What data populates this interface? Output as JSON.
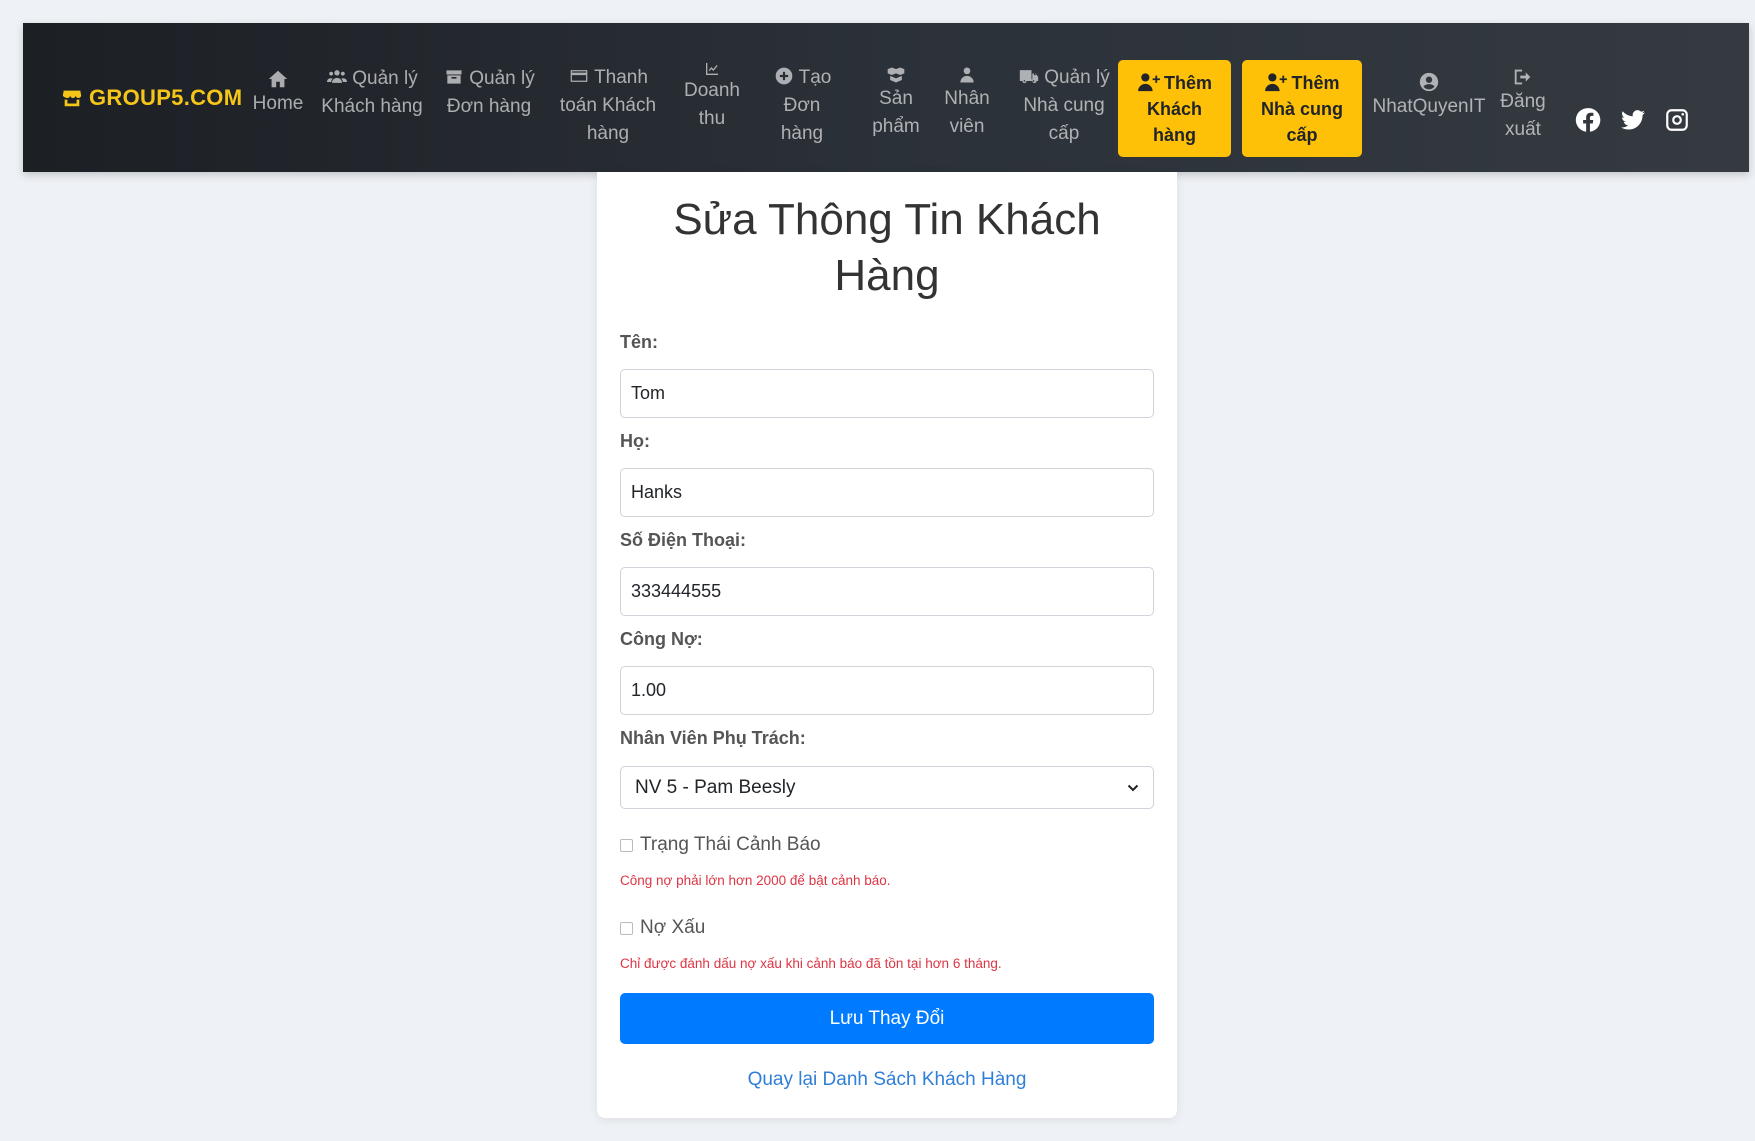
{
  "brand": {
    "name": "GROUP5.COM"
  },
  "nav": {
    "home": "Home",
    "customers_1": "Quản lý",
    "customers_2": "Khách hàng",
    "orders_1": "Quản lý",
    "orders_2": "Đơn hàng",
    "payment_1": "Thanh",
    "payment_2": "toán Khách",
    "payment_3": "hàng",
    "revenue_1": "Doanh",
    "revenue_2": "thu",
    "create_order_1": "Tạo",
    "create_order_2": "Đơn",
    "create_order_3": "hàng",
    "products_1": "Sản",
    "products_2": "phẩm",
    "staff_1": "Nhân",
    "staff_2": "viên",
    "suppliers_1": "Quản lý",
    "suppliers_2": "Nhà cung",
    "suppliers_3": "cấp",
    "add_customer_1": "Thêm",
    "add_customer_2": "Khách",
    "add_customer_3": "hàng",
    "add_supplier_1": "Thêm",
    "add_supplier_2": "Nhà cung",
    "add_supplier_3": "cấp",
    "user": "NhatQuyenIT",
    "logout_1": "Đăng",
    "logout_2": "xuất"
  },
  "icons": {
    "brand": "store-icon",
    "home": "home-icon",
    "customers": "users-icon",
    "orders": "box-icon",
    "payment": "credit-card-icon",
    "revenue": "chart-line-icon",
    "create_order": "plus-circle-icon",
    "products": "boxes-icon",
    "staff": "user-icon",
    "suppliers": "truck-icon",
    "add": "user-plus-icon",
    "user": "user-circle-icon",
    "logout": "sign-out-icon",
    "social": [
      "facebook-icon",
      "twitter-icon",
      "instagram-icon"
    ]
  },
  "colors": {
    "accent": "#ffc107",
    "primary": "#007bff",
    "danger": "#dc3545",
    "link": "#2f7fd8"
  },
  "form": {
    "title_1": "Sửa Thông Tin Khách",
    "title_2": "Hàng",
    "first_name_label": "Tên:",
    "first_name_value": "Tom",
    "last_name_label": "Họ:",
    "last_name_value": "Hanks",
    "phone_label": "Số Điện Thoại:",
    "phone_value": "333444555",
    "debt_label": "Công Nợ:",
    "debt_value": "1.00",
    "staff_label": "Nhân Viên Phụ Trách:",
    "staff_selected": "NV 5 - Pam Beesly",
    "warning_status_label": "Trạng Thái Cảnh Báo",
    "warning_status_checked": false,
    "warning_status_note": "Công nợ phải lớn hơn 2000 để bật cảnh báo.",
    "bad_debt_label": "Nợ Xấu",
    "bad_debt_checked": false,
    "bad_debt_note": "Chỉ được đánh dấu nợ xấu khi cảnh báo đã tồn tại hơn 6 tháng.",
    "save_button": "Lưu Thay Đổi",
    "back_link": "Quay lại Danh Sách Khách Hàng"
  }
}
